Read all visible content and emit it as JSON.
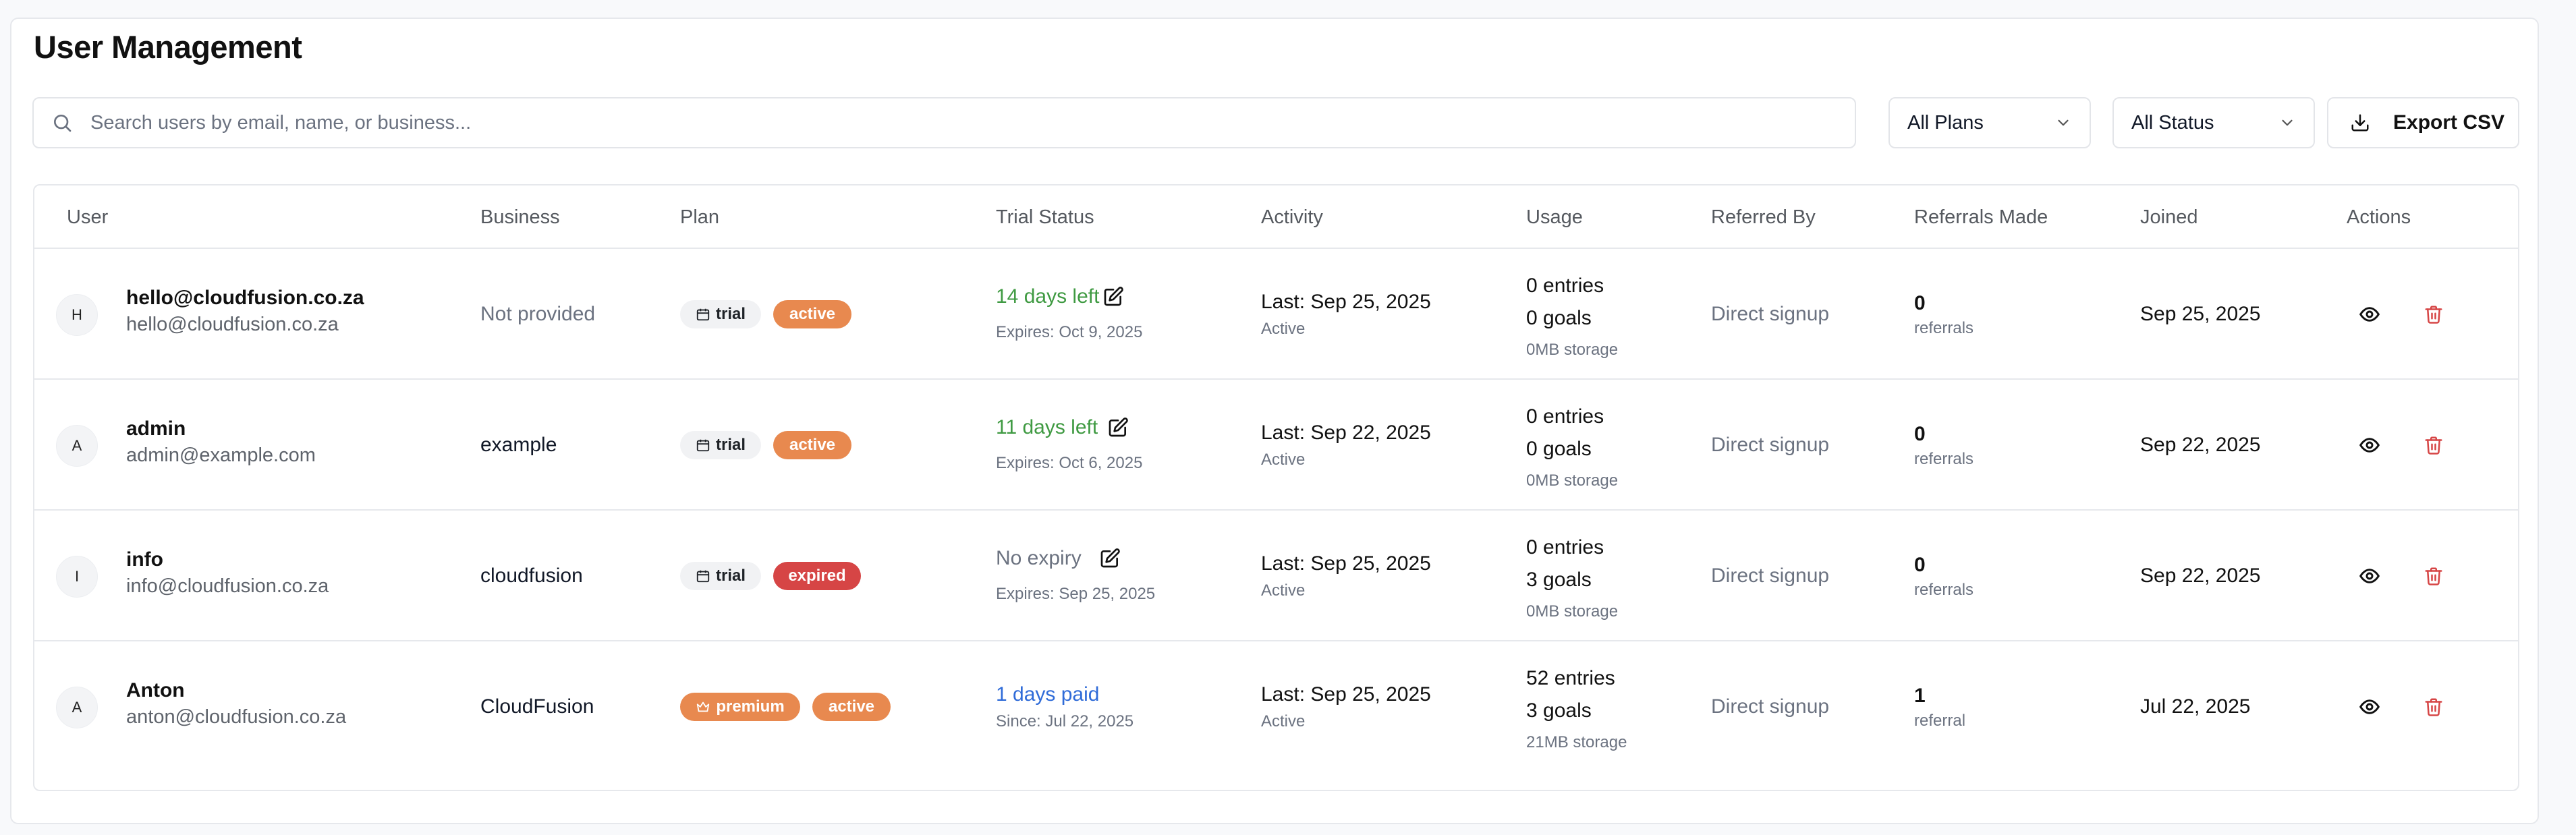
{
  "title": "User Management",
  "search": {
    "placeholder": "Search users by email, name, or business..."
  },
  "filters": {
    "plans": "All Plans",
    "status": "All Status"
  },
  "export_label": "Export CSV",
  "columns": [
    "User",
    "Business",
    "Plan",
    "Trial Status",
    "Activity",
    "Usage",
    "Referred By",
    "Referrals Made",
    "Joined",
    "Actions"
  ],
  "rows": [
    {
      "initial": "H",
      "name": "hello@cloudfusion.co.za",
      "email": "hello@cloudfusion.co.za",
      "business": "Not provided",
      "plan": "trial",
      "status": "active",
      "trial_main": "14 days left",
      "trial_sub": "Expires: Oct 9, 2025",
      "activity": "Last: Sep 25, 2025",
      "activity_sub": "Active",
      "entries": "0 entries",
      "goals": "0 goals",
      "storage": "0MB storage",
      "referred_by": "Direct signup",
      "referrals": "0",
      "referrals_label": "referrals",
      "joined": "Sep 25, 2025"
    },
    {
      "initial": "A",
      "name": "admin",
      "email": "admin@example.com",
      "business": "example",
      "plan": "trial",
      "status": "active",
      "trial_main": "11 days left",
      "trial_sub": "Expires: Oct 6, 2025",
      "activity": "Last: Sep 22, 2025",
      "activity_sub": "Active",
      "entries": "0 entries",
      "goals": "0 goals",
      "storage": "0MB storage",
      "referred_by": "Direct signup",
      "referrals": "0",
      "referrals_label": "referrals",
      "joined": "Sep 22, 2025"
    },
    {
      "initial": "I",
      "name": "info",
      "email": "info@cloudfusion.co.za",
      "business": "cloudfusion",
      "plan": "trial",
      "status": "expired",
      "trial_main": "No expiry",
      "trial_sub": "Expires: Sep 25, 2025",
      "activity": "Last: Sep 25, 2025",
      "activity_sub": "Active",
      "entries": "0 entries",
      "goals": "3 goals",
      "storage": "0MB storage",
      "referred_by": "Direct signup",
      "referrals": "0",
      "referrals_label": "referrals",
      "joined": "Sep 22, 2025"
    },
    {
      "initial": "A",
      "name": "Anton",
      "email": "anton@cloudfusion.co.za",
      "business": "CloudFusion",
      "plan": "premium",
      "status": "active",
      "trial_main": "1 days paid",
      "trial_sub": "Since: Jul 22, 2025",
      "activity": "Last: Sep 25, 2025",
      "activity_sub": "Active",
      "entries": "52 entries",
      "goals": "3 goals",
      "storage": "21MB storage",
      "referred_by": "Direct signup",
      "referrals": "1",
      "referrals_label": "referral",
      "joined": "Jul 22, 2025"
    }
  ],
  "colors": {
    "green": "#3f9a42",
    "blue": "#2f6bd8",
    "orange": "#e8894f",
    "red": "#d64545",
    "delete": "#d64545"
  }
}
